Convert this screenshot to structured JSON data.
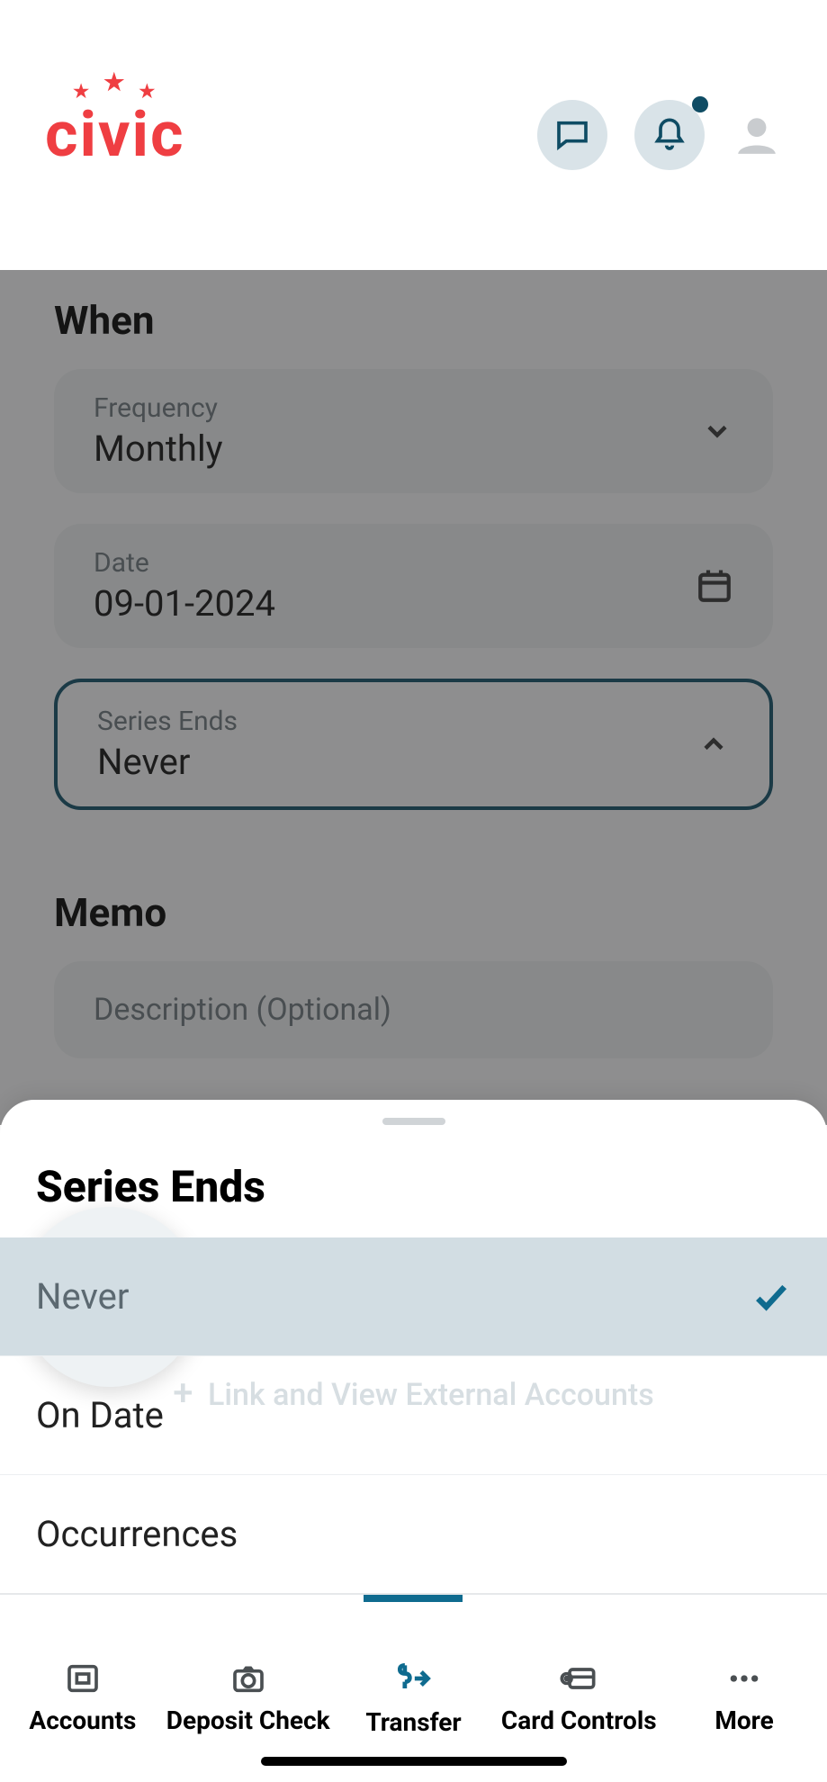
{
  "brand": {
    "name": "civic"
  },
  "header": {
    "has_notification_dot": true
  },
  "form": {
    "when": {
      "title": "When",
      "frequency": {
        "label": "Frequency",
        "value": "Monthly"
      },
      "date": {
        "label": "Date",
        "value": "09-01-2024"
      },
      "series_ends": {
        "label": "Series Ends",
        "value": "Never"
      }
    },
    "memo": {
      "title": "Memo",
      "placeholder": "Description (Optional)"
    }
  },
  "sheet": {
    "title": "Series Ends",
    "ghost_link": "Link and View External Accounts",
    "options": [
      {
        "label": "Never",
        "selected": true
      },
      {
        "label": "On Date",
        "selected": false
      },
      {
        "label": "Occurrences",
        "selected": false
      }
    ]
  },
  "tabs": {
    "accounts": "Accounts",
    "deposit": "Deposit Check",
    "transfer": "Transfer",
    "card": "Card Controls",
    "more": "More"
  }
}
